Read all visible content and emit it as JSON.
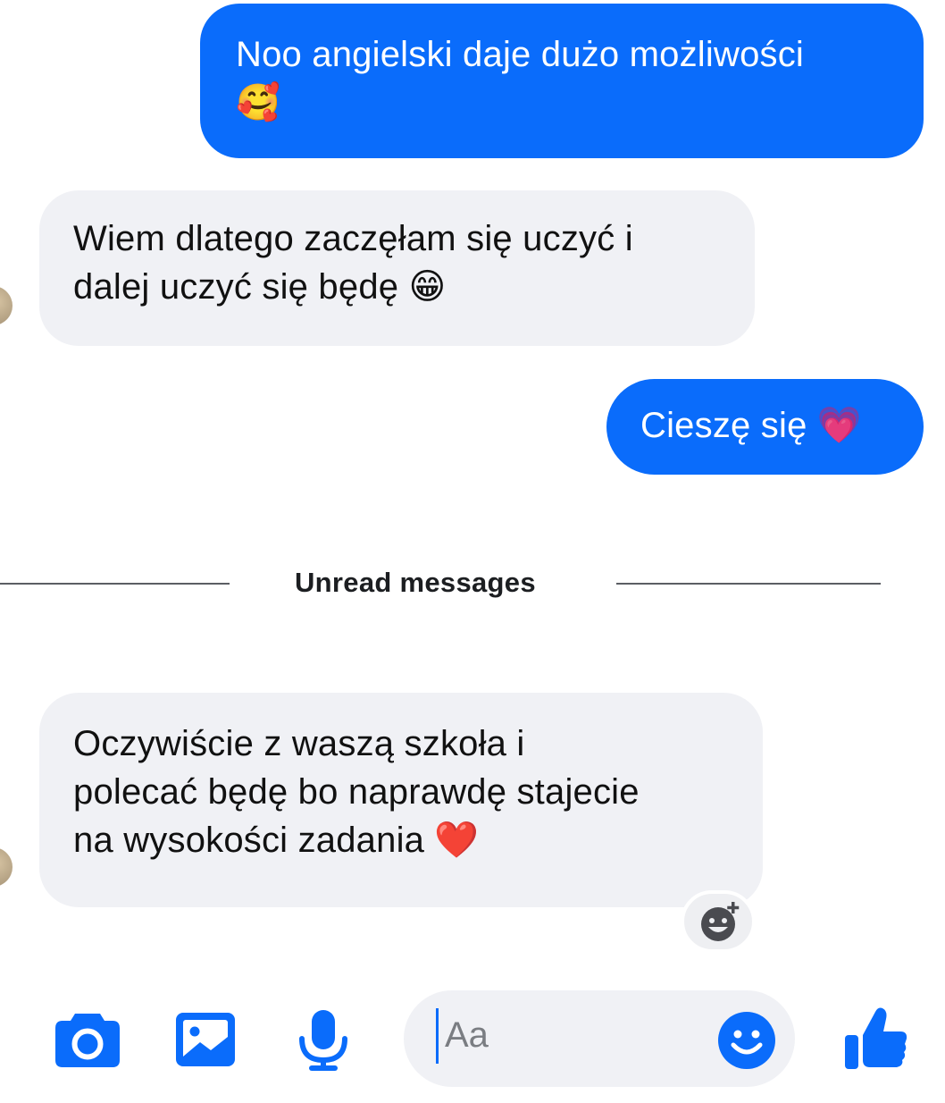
{
  "colors": {
    "brand_blue": "#0a6cfb",
    "incoming_bubble": "#f0f1f5",
    "outgoing_text": "#ffffff"
  },
  "messages": [
    {
      "direction": "outgoing",
      "lines": [
        "Noo angielski daje dużo możliwości",
        "🥰"
      ]
    },
    {
      "direction": "incoming",
      "lines": [
        "Wiem dlatego zaczęłam się uczyć i",
        "dalej uczyć się będę 😁"
      ]
    },
    {
      "direction": "outgoing",
      "lines": [
        "Cieszę się 💗"
      ]
    },
    {
      "direction": "incoming",
      "lines": [
        "Oczywiście z waszą szkoła i",
        "polecać będę bo naprawdę stajecie",
        "na wysokości zadania ❤️"
      ]
    }
  ],
  "divider": {
    "label": "Unread messages"
  },
  "composer": {
    "placeholder": "Aa"
  },
  "icons": {
    "camera": "camera-icon",
    "gallery": "image-icon",
    "microphone": "microphone-icon",
    "emoji": "smiley-icon",
    "like": "thumbs-up-icon",
    "add_reaction": "add-reaction-icon"
  }
}
